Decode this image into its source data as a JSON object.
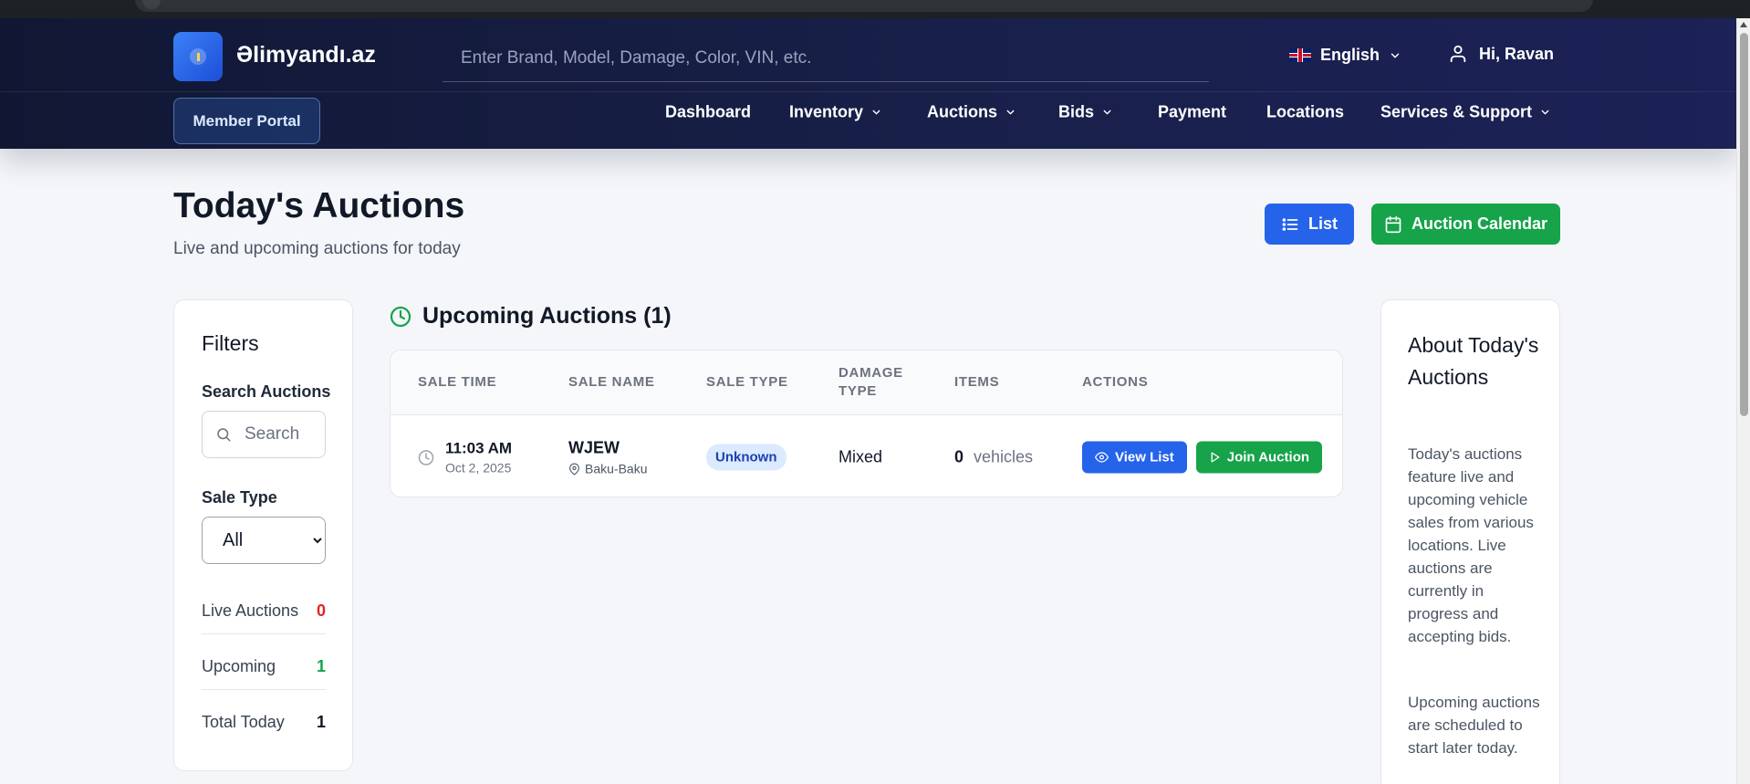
{
  "header": {
    "brand": "Əlimyandı.az",
    "search_placeholder": "Enter Brand, Model, Damage, Color, VIN, etc.",
    "language": "English",
    "greeting": "Hi, Ravan"
  },
  "nav": {
    "member_portal": "Member Portal",
    "items": [
      {
        "label": "Dashboard",
        "dropdown": false
      },
      {
        "label": "Inventory",
        "dropdown": true
      },
      {
        "label": "Auctions",
        "dropdown": true
      },
      {
        "label": "Bids",
        "dropdown": true
      },
      {
        "label": "Payment",
        "dropdown": false
      },
      {
        "label": "Locations",
        "dropdown": false
      },
      {
        "label": "Services & Support",
        "dropdown": true
      }
    ]
  },
  "page": {
    "title": "Today's Auctions",
    "subtitle": "Live and upcoming auctions for today",
    "list_button": "List",
    "calendar_button": "Auction Calendar"
  },
  "filters": {
    "title": "Filters",
    "search_label": "Search Auctions",
    "search_placeholder": "Search",
    "sale_type_label": "Sale Type",
    "sale_type_value": "All",
    "stats": [
      {
        "label": "Live Auctions",
        "value": "0",
        "color": "#dc2626"
      },
      {
        "label": "Upcoming",
        "value": "1",
        "color": "#16a34a"
      },
      {
        "label": "Total Today",
        "value": "1",
        "color": "#111827"
      }
    ]
  },
  "upcoming": {
    "title": "Upcoming Auctions (1)",
    "columns": {
      "sale_time": "Sale Time",
      "sale_name": "Sale Name",
      "sale_type": "Sale Type",
      "damage_type_1": "Damage",
      "damage_type_2": "Type",
      "items": "Items",
      "actions": "Actions"
    },
    "rows": [
      {
        "time": "11:03 AM",
        "date": "Oct 2, 2025",
        "name": "WJEW",
        "location": "Baku-Baku",
        "sale_type": "Unknown",
        "damage_type": "Mixed",
        "items_count": "0",
        "items_unit": "vehicles",
        "view_label": "View List",
        "join_label": "Join Auction"
      }
    ]
  },
  "about": {
    "title": "About Today's Auctions",
    "paragraph_1": "Today's auctions feature live and upcoming vehicle sales from various locations. Live auctions are currently in progress and accepting bids.",
    "paragraph_2": "Upcoming auctions are scheduled to start later today."
  },
  "colors": {
    "header_dark": "#111733",
    "primary_blue": "#2563eb",
    "success_green": "#16a34a",
    "live_red": "#dc2626"
  },
  "icons": {
    "logo": "logo-icon",
    "user": "user-icon",
    "list": "list-icon",
    "calendar": "calendar-icon",
    "search": "search-icon",
    "clock": "clock-icon",
    "map_pin": "map-pin-icon",
    "eye": "eye-icon",
    "play": "play-icon",
    "chevron": "chevron-down-icon"
  }
}
